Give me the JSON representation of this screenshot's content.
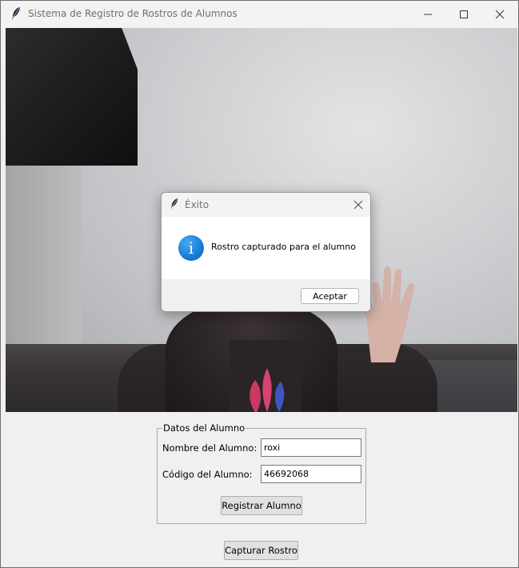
{
  "window": {
    "title": "Sistema de Registro de Rostros de Alumnos",
    "icons": {
      "app": "feather-icon",
      "minimize": "minimize-icon",
      "maximize": "maximize-icon",
      "close": "close-icon"
    }
  },
  "dialog": {
    "title": "Éxito",
    "message": "Rostro capturado para el alumno",
    "ok_label": "Aceptar",
    "icons": {
      "app": "feather-icon",
      "info": "info-icon",
      "close": "close-icon"
    },
    "info_glyph": "i",
    "info_color": "#1a7fd8"
  },
  "form": {
    "legend": "Datos del Alumno",
    "name_label": "Nombre del Alumno:",
    "name_value": "roxi",
    "code_label": "Código del Alumno:",
    "code_value": "46692068",
    "register_label": "Registrar Alumno"
  },
  "actions": {
    "capture_label": "Capturar Rostro"
  },
  "colors": {
    "window_bg": "#f0f0f0",
    "titlebar_bg": "#f3f3f3",
    "button_bg": "#e1e1e1"
  }
}
